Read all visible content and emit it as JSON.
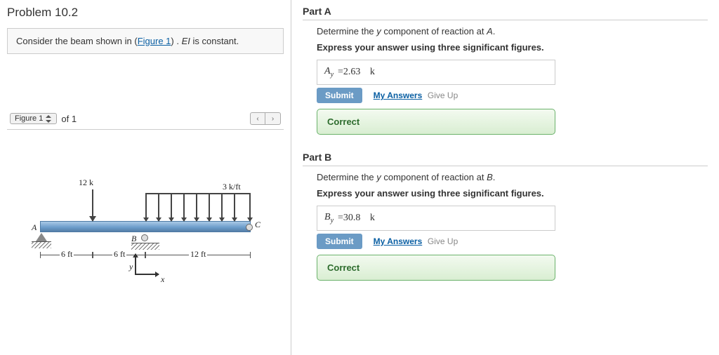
{
  "problem": {
    "title": "Problem 10.2",
    "statement_pre": "Consider the beam shown in (",
    "figure_link": "Figure 1",
    "statement_post": ") . ",
    "ei_text": "EI",
    "statement_tail": " is constant."
  },
  "figure_nav": {
    "select_label": "Figure 1",
    "of_text": "of 1"
  },
  "figure": {
    "point_load": "12 k",
    "dist_load": "3 k/ft",
    "labelA": "A",
    "labelB": "B",
    "labelC": "C",
    "dim1": "6 ft",
    "dim2": "6 ft",
    "dim3": "12 ft",
    "axis_y": "y",
    "axis_x": "x"
  },
  "parts": [
    {
      "heading": "Part A",
      "prompt_pre": "Determine the ",
      "prompt_var": "y",
      "prompt_mid": " component of reaction at ",
      "prompt_pt": "A",
      "prompt_post": ".",
      "instruction": "Express your answer using three significant figures.",
      "lhs_sym": "A",
      "lhs_sub": "y",
      "equals": " = ",
      "value": "2.63",
      "unit": "k",
      "submit": "Submit",
      "my_answers": "My Answers",
      "give_up": "Give Up",
      "feedback": "Correct"
    },
    {
      "heading": "Part B",
      "prompt_pre": "Determine the ",
      "prompt_var": "y",
      "prompt_mid": " component of reaction at ",
      "prompt_pt": "B",
      "prompt_post": ".",
      "instruction": "Express your answer using three significant figures.",
      "lhs_sym": "B",
      "lhs_sub": "y",
      "equals": " = ",
      "value": "30.8",
      "unit": "k",
      "submit": "Submit",
      "my_answers": "My Answers",
      "give_up": "Give Up",
      "feedback": "Correct"
    }
  ]
}
